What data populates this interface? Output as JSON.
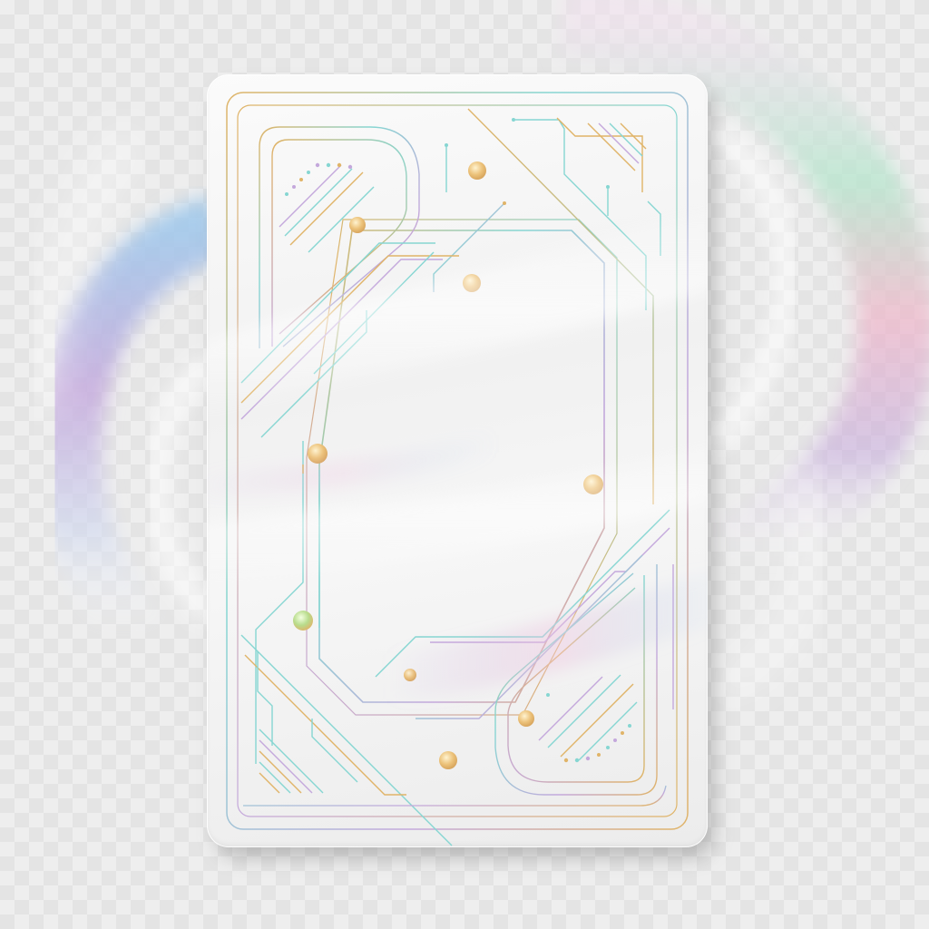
{
  "scene": {
    "subject_icon": "holographic-card-icon",
    "colors": {
      "background_light": "#eeeeee",
      "background_check": "#e4e4e4",
      "card_surface": "#f4f4f4",
      "gold": "#e0b468",
      "teal": "#86d6d2",
      "lavender": "#c4a8dc",
      "pink": "#f0b4c8",
      "blue": "#9ec8ec",
      "mint": "#b4e6cc"
    }
  }
}
